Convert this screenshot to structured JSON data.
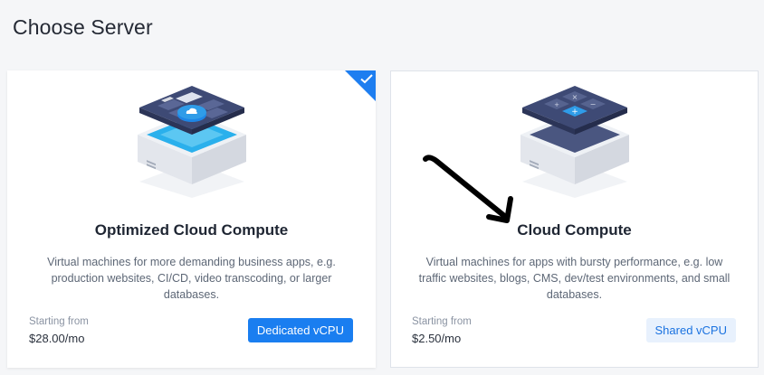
{
  "page": {
    "title": "Choose Server"
  },
  "servers": [
    {
      "title": "Optimized Cloud Compute",
      "description": "Virtual machines for more demanding business apps, e.g. production websites, CI/CD, video transcoding, or larger databases.",
      "starting_label": "Starting from",
      "price": "$28.00/mo",
      "badge": "Dedicated vCPU",
      "selected": true
    },
    {
      "title": "Cloud Compute",
      "description": "Virtual machines for apps with bursty performance, e.g. low traffic websites, blogs, CMS, dev/test environments, and small databases.",
      "starting_label": "Starting from",
      "price": "$2.50/mo",
      "badge": "Shared vCPU",
      "selected": false
    }
  ],
  "icons": {
    "selected_indicator": "checkmark-icon",
    "optimized_illustration": "server-chip-illustration-icon",
    "cloud_illustration": "server-calculator-illustration-icon",
    "annotation": "hand-drawn-arrow-icon"
  },
  "colors": {
    "accent": "#1a7ef0",
    "shared_badge_bg": "#e8f1fd",
    "chip_dark": "#3e4a75",
    "chip_light": "#2f9ce8"
  }
}
